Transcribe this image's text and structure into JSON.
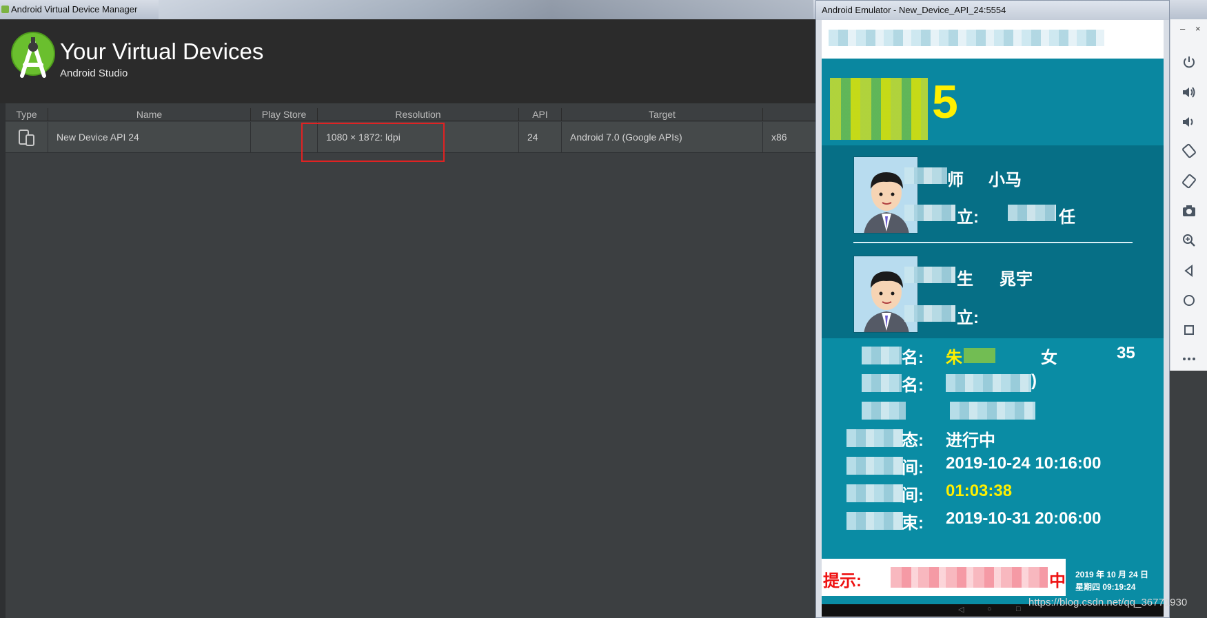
{
  "avd": {
    "window_title": "Android Virtual Device Manager",
    "title": "Your Virtual Devices",
    "subtitle": "Android Studio",
    "columns": [
      "Type",
      "Name",
      "Play Store",
      "Resolution",
      "API",
      "Target",
      ""
    ],
    "row": {
      "name": "New Device API 24",
      "play_store": "",
      "resolution": "1080 × 1872: ldpi",
      "api": "24",
      "target": "Android 7.0 (Google APIs)",
      "cpu": "x86"
    },
    "type_icon": "devices-icon",
    "highlight_color": "#e02222"
  },
  "emulator": {
    "window_title": "Android Emulator - New_Device_API_24:5554",
    "header_suffix": "5",
    "staff": [
      {
        "name_label": "师",
        "name": "小马",
        "role_label": "立:",
        "role": "任"
      },
      {
        "name_label": "生",
        "name": "晁宇",
        "role_label": "立:",
        "role": ""
      }
    ],
    "info": {
      "name_label": "名:",
      "patient_name": "朱",
      "gender": "女",
      "age": "35",
      "row2_label": "名:",
      "row2_value": ")",
      "row3_label": "",
      "row3_value": "",
      "status_label": "态:",
      "status": "进行中",
      "start_label": "间:",
      "start_time": "2019-10-24 10:16:00",
      "elapsed_label": "间:",
      "elapsed": "01:03:38",
      "end_label": "束:",
      "end_time": "2019-10-31 20:06:00"
    },
    "notice": "提示:",
    "notice_right": "中",
    "clock_date": "2019 年 10 月 24 日",
    "clock_time": "星期四   09:19:24",
    "nav": [
      "◁",
      "○",
      "□"
    ]
  },
  "toolbar": {
    "window_buttons": [
      "–",
      "×"
    ],
    "tools": [
      "power-icon",
      "volume-up-icon",
      "volume-down-icon",
      "rotate-left-icon",
      "rotate-right-icon",
      "camera-icon",
      "zoom-icon",
      "back-icon",
      "home-icon",
      "overview-icon",
      "more-icon"
    ]
  },
  "watermark": "https://blog.csdn.net/qq_36771930"
}
